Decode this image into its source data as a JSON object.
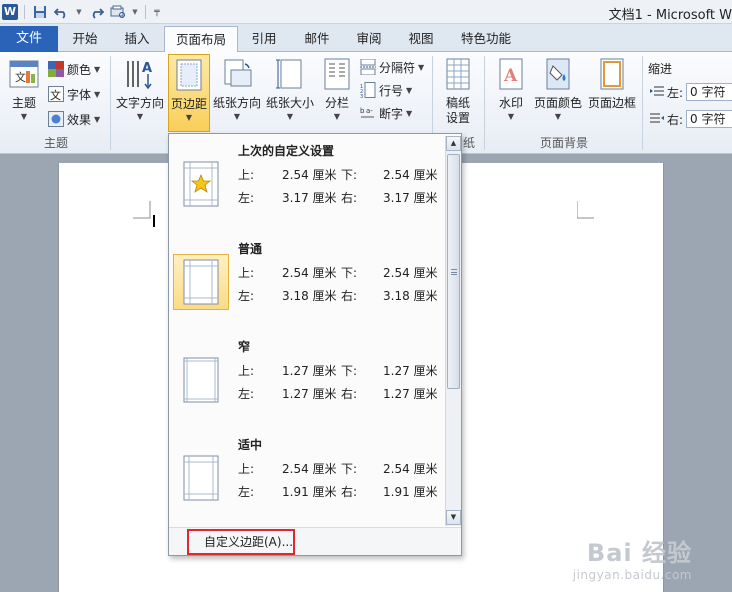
{
  "window": {
    "title": "文档1 - Microsoft W"
  },
  "tabs": {
    "file": "文件",
    "items": [
      "开始",
      "插入",
      "页面布局",
      "引用",
      "邮件",
      "审阅",
      "视图",
      "特色功能"
    ]
  },
  "ribbon": {
    "themes": {
      "big_button": "主题",
      "colors": "颜色",
      "fonts": "字体",
      "effects": "效果",
      "group_label": "主题"
    },
    "page_setup": {
      "text_direction": "文字方向",
      "margins": "页边距",
      "orientation": "纸张方向",
      "size": "纸张大小",
      "columns": "分栏",
      "breaks": "分隔符",
      "line_numbers": "行号",
      "hyphenation": "断字",
      "group_label_tail": "纸"
    },
    "manuscript": {
      "line1": "稿纸",
      "line2": "设置"
    },
    "page_background": {
      "watermark": "水印",
      "page_color": "页面颜色",
      "page_borders": "页面边框",
      "group_label": "页面背景"
    },
    "paragraph": {
      "indent_label": "缩进",
      "left_label": "左:",
      "left_value": "0 字符",
      "right_label": "右:",
      "right_value": "0 字符"
    }
  },
  "margins_dropdown": {
    "options": [
      {
        "name": "上次的自定义设置",
        "top_label": "上:",
        "top_value": "2.54 厘米",
        "bottom_label": "下:",
        "bottom_value": "2.54 厘米",
        "left_label": "左:",
        "left_value": "3.17 厘米",
        "right_label": "右:",
        "right_value": "3.17 厘米",
        "icon": "star-page-icon"
      },
      {
        "name": "普通",
        "top_label": "上:",
        "top_value": "2.54 厘米",
        "bottom_label": "下:",
        "bottom_value": "2.54 厘米",
        "left_label": "左:",
        "left_value": "3.18 厘米",
        "right_label": "右:",
        "right_value": "3.18 厘米",
        "icon": "page-margins-icon",
        "selected": true
      },
      {
        "name": "窄",
        "top_label": "上:",
        "top_value": "1.27 厘米",
        "bottom_label": "下:",
        "bottom_value": "1.27 厘米",
        "left_label": "左:",
        "left_value": "1.27 厘米",
        "right_label": "右:",
        "right_value": "1.27 厘米",
        "icon": "page-margins-icon"
      },
      {
        "name": "适中",
        "top_label": "上:",
        "top_value": "2.54 厘米",
        "bottom_label": "下:",
        "bottom_value": "2.54 厘米",
        "left_label": "左:",
        "left_value": "1.91 厘米",
        "right_label": "右:",
        "right_value": "1.91 厘米",
        "icon": "page-margins-icon"
      }
    ],
    "custom_label": "自定义边距(A)..."
  },
  "watermark_text": {
    "main": "Bai 经验",
    "sub": "jingyan.baidu.com"
  },
  "colors": {
    "file_tab": "#2a63b8",
    "highlight": "#f9cf5a",
    "callout": "#e0282e"
  }
}
